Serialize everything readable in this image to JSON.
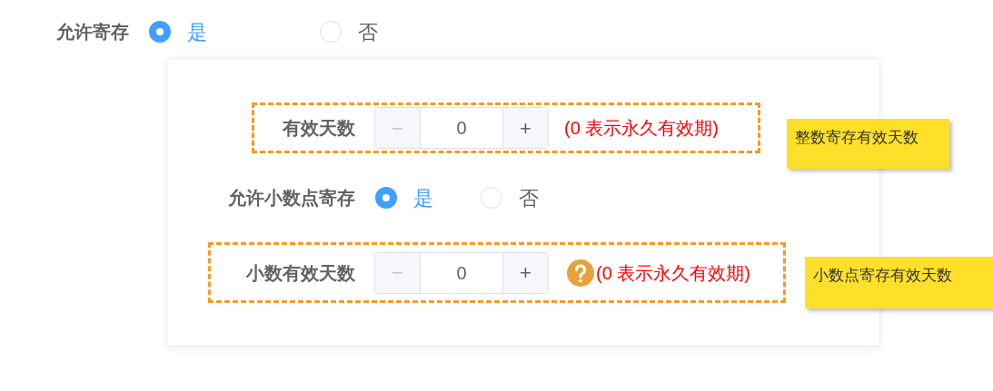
{
  "top_field": {
    "label": "允许寄存",
    "options": [
      {
        "label": "是",
        "selected": true
      },
      {
        "label": "否",
        "selected": false
      }
    ]
  },
  "card": {
    "rows": [
      {
        "kind": "stepper",
        "label": "有效天数",
        "decrement": "−",
        "value": "0",
        "increment": "+",
        "help_icon": false,
        "hint": "(0 表示永久有效期)",
        "highlighted": true
      },
      {
        "kind": "radio",
        "label": "允许小数点寄存",
        "options": [
          {
            "label": "是",
            "selected": true
          },
          {
            "label": "否",
            "selected": false
          }
        ]
      },
      {
        "kind": "stepper",
        "label": "小数有效天数",
        "decrement": "−",
        "value": "0",
        "increment": "+",
        "help_icon": true,
        "hint": "(0 表示永久有效期)",
        "highlighted": true
      }
    ]
  },
  "sticky_notes": [
    "整数寄存有效天数",
    "小数点寄存有效天数"
  ]
}
